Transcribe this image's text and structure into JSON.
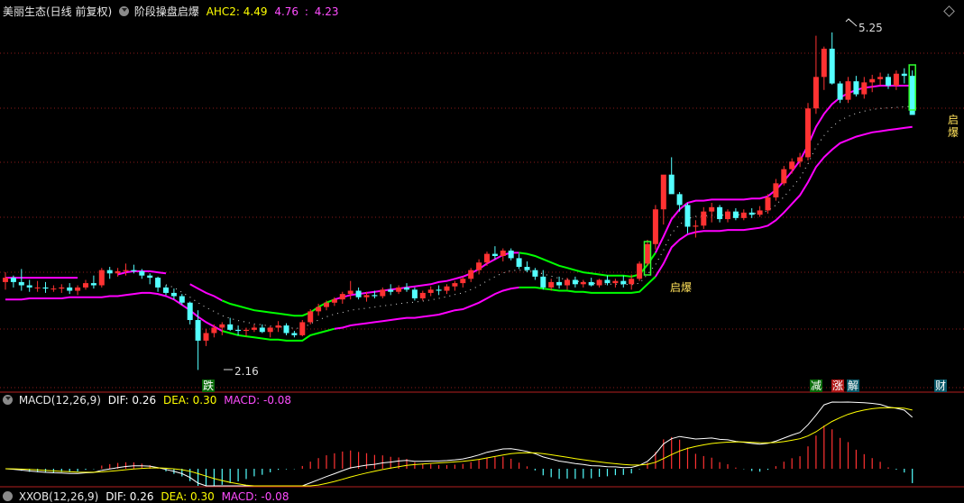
{
  "header": {
    "stock": "美丽生态(日线 前复权)",
    "indicator": "阶段操盘启爆",
    "ahc_label": "AHC2: 4.49",
    "ahc_v2": "4.76",
    "ahc_sep": ":",
    "ahc_v3": "4.23"
  },
  "macd_header": {
    "name": "MACD(12,26,9)",
    "dif": "DIF: 0.26",
    "dea": "DEA: 0.30",
    "macd": "MACD: -0.08"
  },
  "second_header": {
    "name": "XXOB(12,26,9)",
    "dif": "DIF: 0.26",
    "dea": "DEA: 0.30",
    "macd": "MACD: -0.08"
  },
  "price_labels": {
    "high": "5.25",
    "low": "2.16"
  },
  "signals": {
    "die": "跌",
    "qibao_1": "启爆",
    "qibao_2": "启爆",
    "jian": "减",
    "zhang": "涨",
    "jie": "解",
    "cai": "财"
  },
  "colors": {
    "background": "#000000",
    "up": "#ff3232",
    "down": "#54ffff",
    "upper_band": "#ff00ff",
    "green_band": "#00ff00",
    "dif": "#ffffff",
    "dea": "#ffff00",
    "macd_text": "#ff00ff",
    "grid": "#8b1a1a"
  },
  "chart_data": [
    {
      "type": "candlestick",
      "title": "美丽生态(日线 前复权)",
      "y_range": [
        2.0,
        5.4
      ],
      "high_mark": 5.25,
      "low_mark": 2.16,
      "last_values": {
        "AHC2": 4.49,
        "upper": 4.76,
        "lower": 4.23
      },
      "candles": [
        [
          2.95,
          3.04,
          2.88,
          2.99
        ],
        [
          2.99,
          3.01,
          2.9,
          2.95
        ],
        [
          2.95,
          3.07,
          2.87,
          2.92
        ],
        [
          2.92,
          2.97,
          2.86,
          2.9
        ],
        [
          2.9,
          2.96,
          2.86,
          2.9
        ],
        [
          2.9,
          2.95,
          2.85,
          2.89
        ],
        [
          2.89,
          2.92,
          2.86,
          2.89
        ],
        [
          2.89,
          2.93,
          2.85,
          2.9
        ],
        [
          2.9,
          2.94,
          2.84,
          2.87
        ],
        [
          2.87,
          2.92,
          2.83,
          2.9
        ],
        [
          2.9,
          2.97,
          2.88,
          2.94
        ],
        [
          2.94,
          3.01,
          2.89,
          2.92
        ],
        [
          2.92,
          3.08,
          2.9,
          3.06
        ],
        [
          3.06,
          3.09,
          2.98,
          3.03
        ],
        [
          3.03,
          3.08,
          3.0,
          3.05
        ],
        [
          3.05,
          3.12,
          3.01,
          3.06
        ],
        [
          3.06,
          3.11,
          3.03,
          3.05
        ],
        [
          3.05,
          3.07,
          2.98,
          3.01
        ],
        [
          3.01,
          3.03,
          2.93,
          2.99
        ],
        [
          2.99,
          3.0,
          2.86,
          2.9
        ],
        [
          2.9,
          2.92,
          2.83,
          2.85
        ],
        [
          2.85,
          2.89,
          2.79,
          2.82
        ],
        [
          2.82,
          2.84,
          2.74,
          2.76
        ],
        [
          2.76,
          2.77,
          2.56,
          2.6
        ],
        [
          2.6,
          2.69,
          2.14,
          2.41
        ],
        [
          2.41,
          2.52,
          2.36,
          2.48
        ],
        [
          2.48,
          2.56,
          2.44,
          2.53
        ],
        [
          2.53,
          2.58,
          2.46,
          2.56
        ],
        [
          2.56,
          2.62,
          2.5,
          2.51
        ],
        [
          2.51,
          2.55,
          2.46,
          2.5
        ],
        [
          2.5,
          2.53,
          2.45,
          2.51
        ],
        [
          2.51,
          2.56,
          2.49,
          2.53
        ],
        [
          2.53,
          2.56,
          2.48,
          2.49
        ],
        [
          2.49,
          2.54,
          2.44,
          2.53
        ],
        [
          2.53,
          2.59,
          2.49,
          2.55
        ],
        [
          2.55,
          2.57,
          2.46,
          2.48
        ],
        [
          2.48,
          2.5,
          2.44,
          2.46
        ],
        [
          2.46,
          2.6,
          2.45,
          2.58
        ],
        [
          2.58,
          2.7,
          2.56,
          2.68
        ],
        [
          2.68,
          2.75,
          2.64,
          2.72
        ],
        [
          2.72,
          2.78,
          2.69,
          2.76
        ],
        [
          2.76,
          2.81,
          2.73,
          2.79
        ],
        [
          2.79,
          2.86,
          2.75,
          2.84
        ],
        [
          2.84,
          2.96,
          2.79,
          2.87
        ],
        [
          2.87,
          2.9,
          2.79,
          2.81
        ],
        [
          2.81,
          2.86,
          2.77,
          2.83
        ],
        [
          2.83,
          2.87,
          2.8,
          2.82
        ],
        [
          2.82,
          2.9,
          2.8,
          2.88
        ],
        [
          2.88,
          2.93,
          2.83,
          2.86
        ],
        [
          2.86,
          2.92,
          2.84,
          2.9
        ],
        [
          2.9,
          2.94,
          2.86,
          2.88
        ],
        [
          2.88,
          2.9,
          2.78,
          2.8
        ],
        [
          2.8,
          2.87,
          2.78,
          2.85
        ],
        [
          2.85,
          2.91,
          2.82,
          2.88
        ],
        [
          2.88,
          2.92,
          2.83,
          2.87
        ],
        [
          2.87,
          2.93,
          2.84,
          2.91
        ],
        [
          2.91,
          2.96,
          2.87,
          2.94
        ],
        [
          2.94,
          3.0,
          2.9,
          2.98
        ],
        [
          2.98,
          3.08,
          2.95,
          3.06
        ],
        [
          3.06,
          3.16,
          3.02,
          3.13
        ],
        [
          3.13,
          3.23,
          3.1,
          3.21
        ],
        [
          3.21,
          3.28,
          3.16,
          3.19
        ],
        [
          3.19,
          3.26,
          3.14,
          3.24
        ],
        [
          3.24,
          3.26,
          3.15,
          3.17
        ],
        [
          3.17,
          3.21,
          3.07,
          3.09
        ],
        [
          3.09,
          3.14,
          3.04,
          3.06
        ],
        [
          3.06,
          3.08,
          2.97,
          3.0
        ],
        [
          3.0,
          3.06,
          2.88,
          2.9
        ],
        [
          2.9,
          2.98,
          2.87,
          2.95
        ],
        [
          2.95,
          3.0,
          2.89,
          2.92
        ],
        [
          2.92,
          2.99,
          2.88,
          2.97
        ],
        [
          2.97,
          3.0,
          2.9,
          2.93
        ],
        [
          2.93,
          2.97,
          2.9,
          2.95
        ],
        [
          2.95,
          2.99,
          2.91,
          2.92
        ],
        [
          2.92,
          2.98,
          2.9,
          2.97
        ],
        [
          2.97,
          3.01,
          2.92,
          2.94
        ],
        [
          2.94,
          2.98,
          2.9,
          2.96
        ],
        [
          2.96,
          3.01,
          2.9,
          2.93
        ],
        [
          2.93,
          3.02,
          2.88,
          2.98
        ],
        [
          2.98,
          3.14,
          2.96,
          3.12
        ],
        [
          3.12,
          3.34,
          3.1,
          3.3
        ],
        [
          3.3,
          3.66,
          3.25,
          3.62
        ],
        [
          3.62,
          3.91,
          3.48,
          3.94
        ],
        [
          3.94,
          4.1,
          3.86,
          3.76
        ],
        [
          3.76,
          3.78,
          3.6,
          3.66
        ],
        [
          3.66,
          3.68,
          3.4,
          3.46
        ],
        [
          3.46,
          3.52,
          3.36,
          3.47
        ],
        [
          3.47,
          3.64,
          3.44,
          3.6
        ],
        [
          3.6,
          3.68,
          3.5,
          3.64
        ],
        [
          3.64,
          3.66,
          3.5,
          3.53
        ],
        [
          3.53,
          3.62,
          3.5,
          3.6
        ],
        [
          3.6,
          3.63,
          3.52,
          3.54
        ],
        [
          3.54,
          3.62,
          3.52,
          3.59
        ],
        [
          3.59,
          3.63,
          3.54,
          3.57
        ],
        [
          3.57,
          3.65,
          3.55,
          3.61
        ],
        [
          3.61,
          3.76,
          3.58,
          3.73
        ],
        [
          3.73,
          3.9,
          3.7,
          3.86
        ],
        [
          3.86,
          4.02,
          3.84,
          3.99
        ],
        [
          3.99,
          4.09,
          3.95,
          4.06
        ],
        [
          4.06,
          4.14,
          4.01,
          4.1
        ],
        [
          4.1,
          4.6,
          4.07,
          4.55
        ],
        [
          4.55,
          5.22,
          4.5,
          4.84
        ],
        [
          4.84,
          5.12,
          4.72,
          5.1
        ],
        [
          5.1,
          5.25,
          4.77,
          4.78
        ],
        [
          4.78,
          4.8,
          4.6,
          4.63
        ],
        [
          4.63,
          4.84,
          4.6,
          4.8
        ],
        [
          4.8,
          4.85,
          4.66,
          4.68
        ],
        [
          4.68,
          4.84,
          4.64,
          4.79
        ],
        [
          4.79,
          4.86,
          4.7,
          4.82
        ],
        [
          4.82,
          4.88,
          4.76,
          4.84
        ],
        [
          4.84,
          4.87,
          4.73,
          4.76
        ],
        [
          4.76,
          4.9,
          4.72,
          4.87
        ],
        [
          4.87,
          4.92,
          4.78,
          4.85
        ],
        [
          4.85,
          4.9,
          4.62,
          4.49
        ]
      ],
      "upper_band": [
        2.99,
        2.99,
        2.99,
        2.99,
        2.99,
        2.99,
        2.99,
        2.99,
        2.99,
        2.99,
        2.99,
        2.99,
        3.0,
        3.01,
        3.02,
        3.04,
        3.05,
        3.05,
        3.05,
        3.04,
        3.03,
        3.01,
        2.97,
        2.93,
        2.89,
        2.85,
        2.82,
        2.78,
        2.75,
        2.73,
        2.71,
        2.69,
        2.68,
        2.67,
        2.66,
        2.65,
        2.64,
        2.64,
        2.67,
        2.72,
        2.76,
        2.79,
        2.81,
        2.83,
        2.84,
        2.85,
        2.86,
        2.87,
        2.88,
        2.89,
        2.9,
        2.91,
        2.92,
        2.93,
        2.95,
        2.96,
        2.98,
        3.0,
        3.03,
        3.07,
        3.12,
        3.16,
        3.2,
        3.22,
        3.22,
        3.21,
        3.19,
        3.16,
        3.13,
        3.1,
        3.08,
        3.06,
        3.04,
        3.03,
        3.02,
        3.01,
        3.01,
        3.01,
        3.0,
        3.02,
        3.11,
        3.22,
        3.37,
        3.53,
        3.62,
        3.68,
        3.7,
        3.7,
        3.71,
        3.71,
        3.71,
        3.71,
        3.71,
        3.72,
        3.72,
        3.74,
        3.8,
        3.88,
        3.97,
        4.07,
        4.21,
        4.38,
        4.5,
        4.59,
        4.65,
        4.69,
        4.72,
        4.74,
        4.75,
        4.76,
        4.76,
        4.76,
        4.76,
        4.76
      ],
      "lower_band": [
        2.79,
        2.79,
        2.79,
        2.8,
        2.8,
        2.8,
        2.8,
        2.8,
        2.81,
        2.81,
        2.81,
        2.81,
        2.81,
        2.82,
        2.82,
        2.83,
        2.84,
        2.85,
        2.85,
        2.84,
        2.82,
        2.79,
        2.74,
        2.69,
        2.63,
        2.58,
        2.54,
        2.5,
        2.48,
        2.46,
        2.45,
        2.44,
        2.43,
        2.42,
        2.42,
        2.41,
        2.41,
        2.41,
        2.46,
        2.48,
        2.5,
        2.52,
        2.53,
        2.55,
        2.56,
        2.57,
        2.58,
        2.59,
        2.6,
        2.61,
        2.62,
        2.62,
        2.63,
        2.64,
        2.65,
        2.67,
        2.69,
        2.7,
        2.73,
        2.76,
        2.8,
        2.84,
        2.87,
        2.89,
        2.9,
        2.9,
        2.9,
        2.89,
        2.88,
        2.87,
        2.87,
        2.86,
        2.86,
        2.85,
        2.85,
        2.85,
        2.85,
        2.85,
        2.85,
        2.86,
        2.93,
        3.0,
        3.12,
        3.27,
        3.34,
        3.39,
        3.41,
        3.42,
        3.42,
        3.42,
        3.43,
        3.43,
        3.43,
        3.44,
        3.45,
        3.47,
        3.52,
        3.59,
        3.67,
        3.75,
        3.87,
        4.01,
        4.1,
        4.17,
        4.23,
        4.26,
        4.29,
        4.31,
        4.33,
        4.34,
        4.35,
        4.36,
        4.37,
        4.38
      ],
      "green_segments": [
        [
          27,
          40
        ],
        [
          64,
          80
        ]
      ],
      "signals": [
        {
          "text": "跌",
          "bar": 24
        },
        {
          "text": "启爆",
          "bar": 80
        },
        {
          "text": "启爆",
          "bar": 113
        },
        {
          "text": "减",
          "bar": 99
        },
        {
          "text": "涨",
          "bar": 101
        },
        {
          "text": "解",
          "bar": 103
        },
        {
          "text": "财",
          "bar": 112
        }
      ]
    },
    {
      "type": "macd",
      "title": "MACD(12,26,9)",
      "params": [
        12,
        26,
        9
      ],
      "last": {
        "DIF": 0.26,
        "DEA": 0.3,
        "MACD": -0.08
      }
    }
  ]
}
